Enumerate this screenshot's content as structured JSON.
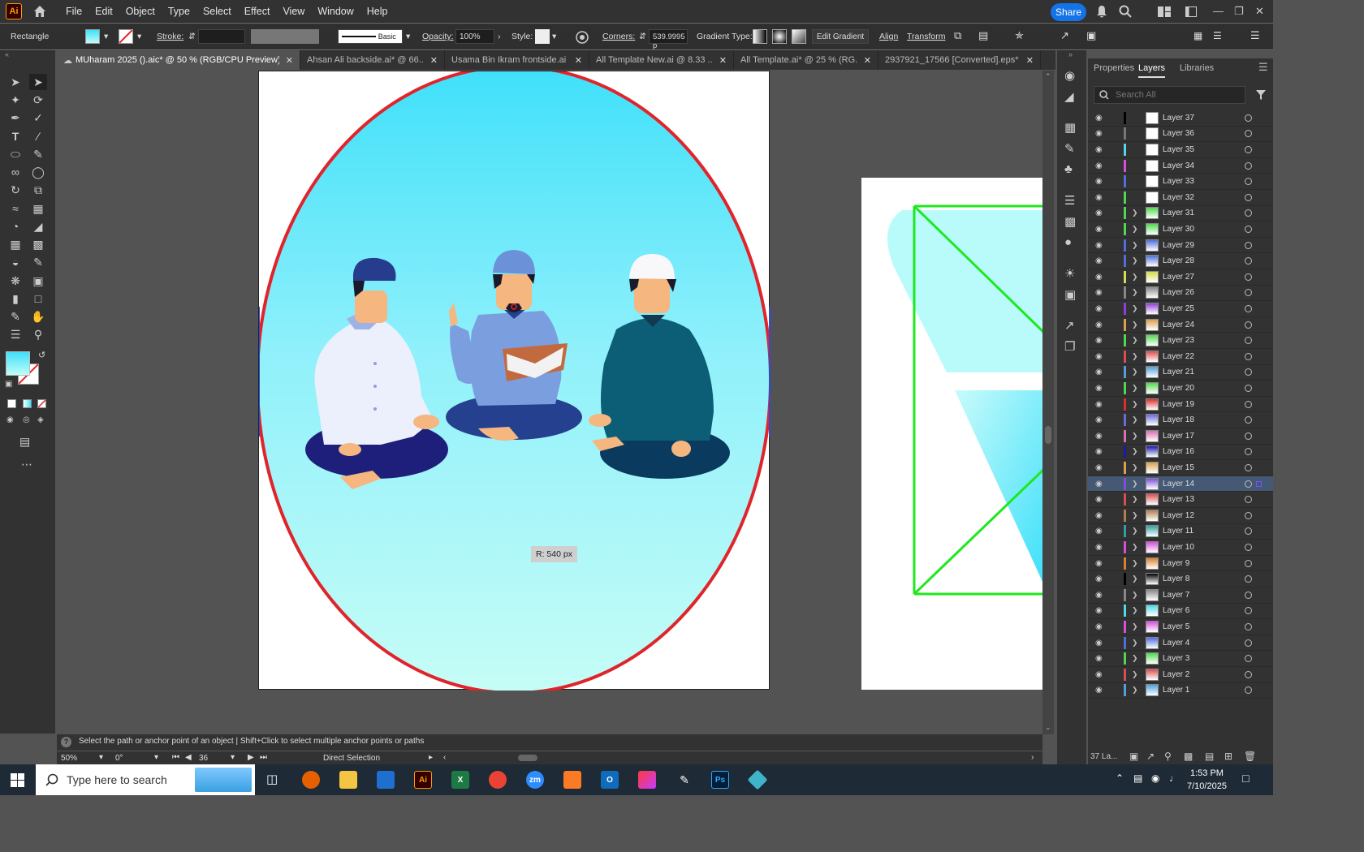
{
  "menubar": {
    "logo": "Ai",
    "items": [
      "File",
      "Edit",
      "Object",
      "Type",
      "Select",
      "Effect",
      "View",
      "Window",
      "Help"
    ],
    "share": "Share"
  },
  "control": {
    "object_type": "Rectangle",
    "stroke_label": "Stroke:",
    "stroke_style": "Basic",
    "opacity_label": "Opacity:",
    "opacity": "100%",
    "style_label": "Style:",
    "corners_label": "Corners:",
    "corners": "539.9995 p",
    "gradient_type_label": "Gradient Type:",
    "edit_gradient": "Edit Gradient",
    "align": "Align",
    "transform": "Transform"
  },
  "tabs": [
    {
      "label": "MUharam 2025 ().aic* @ 50 % (RGB/CPU Preview)",
      "active": true
    },
    {
      "label": "Ahsan Ali backside.ai* @ 66....",
      "active": false
    },
    {
      "label": "Usama Bin Ikram frontside.ai",
      "active": false
    },
    {
      "label": "All Template New.ai @ 8.33 ...",
      "active": false
    },
    {
      "label": "All Template.ai* @ 25 % (RG...",
      "active": false
    },
    {
      "label": "2937921_17566 [Converted].eps*",
      "active": false
    }
  ],
  "canvas": {
    "radius_tooltip": "R: 540 px"
  },
  "panel": {
    "tabs": [
      "Properties",
      "Layers",
      "Libraries"
    ],
    "search_placeholder": "Search All",
    "count": "37 La..."
  },
  "layers": [
    {
      "name": "Layer 37",
      "color": "#000000",
      "sub": false
    },
    {
      "name": "Layer 36",
      "color": "#777777",
      "sub": false
    },
    {
      "name": "Layer 35",
      "color": "#4fd8e8",
      "sub": false
    },
    {
      "name": "Layer 34",
      "color": "#d94fd9",
      "sub": false
    },
    {
      "name": "Layer 33",
      "color": "#4f6fd9",
      "sub": false
    },
    {
      "name": "Layer 32",
      "color": "#4fd94f",
      "sub": false
    },
    {
      "name": "Layer 31",
      "color": "#4fd94f",
      "sub": true
    },
    {
      "name": "Layer 30",
      "color": "#4fd94f",
      "sub": true
    },
    {
      "name": "Layer 29",
      "color": "#4f6fd9",
      "sub": true
    },
    {
      "name": "Layer 28",
      "color": "#4f6fd9",
      "sub": true
    },
    {
      "name": "Layer 27",
      "color": "#d9d94f",
      "sub": true
    },
    {
      "name": "Layer 26",
      "color": "#888888",
      "sub": true
    },
    {
      "name": "Layer 25",
      "color": "#8f3fd9",
      "sub": true
    },
    {
      "name": "Layer 24",
      "color": "#d9a04f",
      "sub": true
    },
    {
      "name": "Layer 23",
      "color": "#4fd94f",
      "sub": true
    },
    {
      "name": "Layer 22",
      "color": "#d94f4f",
      "sub": true
    },
    {
      "name": "Layer 21",
      "color": "#4f9fd9",
      "sub": true
    },
    {
      "name": "Layer 20",
      "color": "#4fd94f",
      "sub": true
    },
    {
      "name": "Layer 19",
      "color": "#d93030",
      "sub": true
    },
    {
      "name": "Layer 18",
      "color": "#6a6ad9",
      "sub": true
    },
    {
      "name": "Layer 17",
      "color": "#d96fb0",
      "sub": true
    },
    {
      "name": "Layer 16",
      "color": "#1a1aaa",
      "sub": true
    },
    {
      "name": "Layer 15",
      "color": "#d9a04f",
      "sub": true
    },
    {
      "name": "Layer 14",
      "color": "#7f4fd9",
      "sub": true
    },
    {
      "name": "Layer 13",
      "color": "#d94f4f",
      "sub": true
    },
    {
      "name": "Layer 12",
      "color": "#b08050",
      "sub": true
    },
    {
      "name": "Layer 11",
      "color": "#30a0a0",
      "sub": true
    },
    {
      "name": "Layer 10",
      "color": "#d94fd9",
      "sub": true
    },
    {
      "name": "Layer 9",
      "color": "#d98030",
      "sub": true
    },
    {
      "name": "Layer 8",
      "color": "#000000",
      "sub": true
    },
    {
      "name": "Layer 7",
      "color": "#888888",
      "sub": true
    },
    {
      "name": "Layer 6",
      "color": "#4fd8e8",
      "sub": true
    },
    {
      "name": "Layer 5",
      "color": "#d94fd9",
      "sub": true
    },
    {
      "name": "Layer 4",
      "color": "#4f6fd9",
      "sub": true
    },
    {
      "name": "Layer 3",
      "color": "#4fd94f",
      "sub": true
    },
    {
      "name": "Layer 2",
      "color": "#d94f4f",
      "sub": true
    },
    {
      "name": "Layer 1",
      "color": "#4f9fd9",
      "sub": true
    }
  ],
  "selected_layer": "Layer 14",
  "status": {
    "hint": "Select the path or anchor point of an object  |  Shift+Click to select multiple anchor points or paths",
    "zoom": "50%",
    "rotate": "0°",
    "artboard": "36",
    "tool": "Direct Selection"
  },
  "taskbar": {
    "search": "Type here to search",
    "time": "1:53 PM",
    "date": "7/10/2025"
  },
  "colors": {
    "accent": "#1473e6",
    "circle_stroke": "#e0242b",
    "green_stroke": "#1ee81e"
  }
}
